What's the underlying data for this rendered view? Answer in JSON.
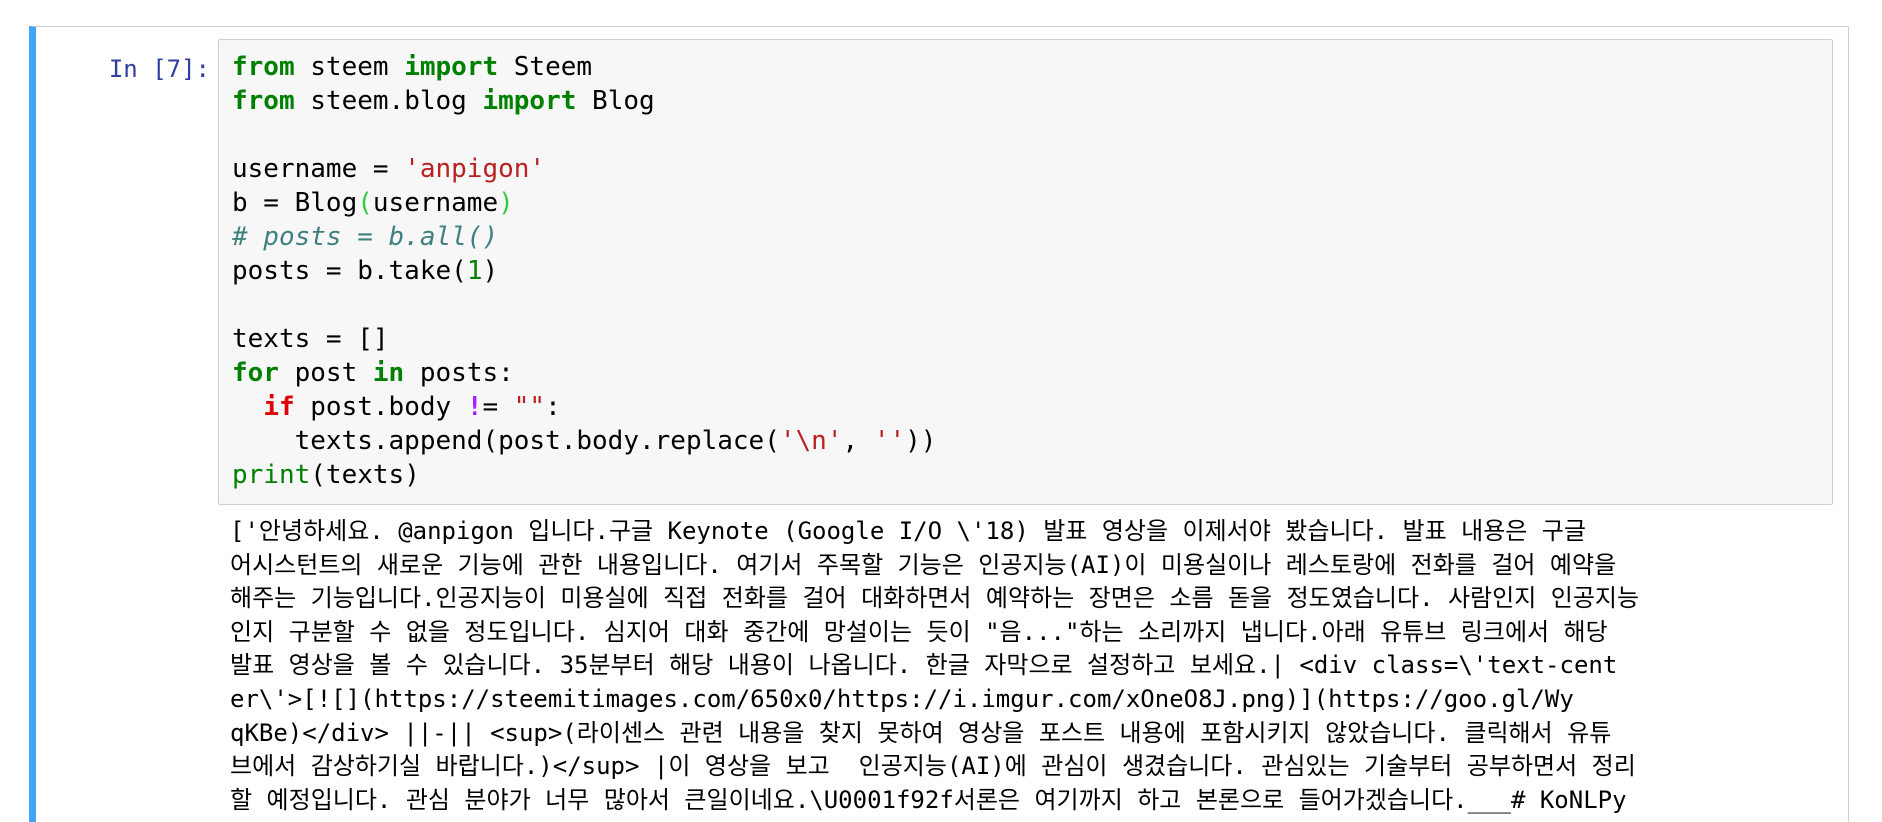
{
  "cell": {
    "prompt": "In [7]:",
    "accent_color": "#42a5f5",
    "code_lines": [
      [
        {
          "t": "from",
          "c": "kw"
        },
        {
          "t": " steem ",
          "c": ""
        },
        {
          "t": "import",
          "c": "kw"
        },
        {
          "t": " Steem",
          "c": ""
        }
      ],
      [
        {
          "t": "from",
          "c": "kw"
        },
        {
          "t": " steem.blog ",
          "c": ""
        },
        {
          "t": "import",
          "c": "kw"
        },
        {
          "t": " Blog",
          "c": ""
        }
      ],
      [],
      [
        {
          "t": "username = ",
          "c": ""
        },
        {
          "t": "'anpigon'",
          "c": "str"
        }
      ],
      [
        {
          "t": "b = Blog",
          "c": ""
        },
        {
          "t": "(",
          "c": "paren-green"
        },
        {
          "t": "username",
          "c": ""
        },
        {
          "t": ")",
          "c": "paren-green"
        }
      ],
      [
        {
          "t": "# posts = b.all()",
          "c": "cmt"
        }
      ],
      [
        {
          "t": "posts = b.take(",
          "c": ""
        },
        {
          "t": "1",
          "c": "num"
        },
        {
          "t": ")",
          "c": ""
        }
      ],
      [],
      [
        {
          "t": "texts = []",
          "c": ""
        }
      ],
      [
        {
          "t": "for",
          "c": "kw"
        },
        {
          "t": " post ",
          "c": ""
        },
        {
          "t": "in",
          "c": "kw"
        },
        {
          "t": " posts:",
          "c": ""
        }
      ],
      [
        {
          "t": "  ",
          "c": ""
        },
        {
          "t": "if",
          "c": "kw-red"
        },
        {
          "t": " post.body ",
          "c": ""
        },
        {
          "t": "!",
          "c": "op-purple"
        },
        {
          "t": "= ",
          "c": ""
        },
        {
          "t": "\"\"",
          "c": "str"
        },
        {
          "t": ":",
          "c": ""
        }
      ],
      [
        {
          "t": "    texts.append(post.body.replace(",
          "c": ""
        },
        {
          "t": "'\\n'",
          "c": "str"
        },
        {
          "t": ", ",
          "c": ""
        },
        {
          "t": "''",
          "c": "str"
        },
        {
          "t": "))",
          "c": ""
        }
      ],
      [
        {
          "t": "print",
          "c": "builtin"
        },
        {
          "t": "(texts)",
          "c": ""
        }
      ]
    ],
    "output_lines": [
      "['안녕하세요. @anpigon 입니다.구글 Keynote (Google I/O \\'18) 발표 영상을 이제서야 봤습니다. 발표 내용은 구글",
      "어시스턴트의 새로운 기능에 관한 내용입니다. 여기서 주목할 기능은 인공지능(AI)이 미용실이나 레스토랑에 전화를 걸어 예약을",
      "해주는 기능입니다.인공지능이 미용실에 직접 전화를 걸어 대화하면서 예약하는 장면은 소름 돋을 정도였습니다. 사람인지 인공지능",
      "인지 구분할 수 없을 정도입니다. 심지어 대화 중간에 망설이는 듯이 \"음...\"하는 소리까지 냅니다.아래 유튜브 링크에서 해당",
      "발표 영상을 볼 수 있습니다. 35분부터 해당 내용이 나옵니다. 한글 자막으로 설정하고 보세요.| <div class=\\'text-cent",
      "er\\'>[![](https://steemitimages.com/650x0/https://i.imgur.com/xOneO8J.png)](https://goo.gl/Wy",
      "qKBe)</div> ||-|| <sup>(라이센스 관련 내용을 찾지 못하여 영상을 포스트 내용에 포함시키지 않았습니다. 클릭해서 유튜",
      "브에서 감상하기실 바랍니다.)</sup> |이 영상을 보고  인공지능(AI)에 관심이 생겼습니다. 관심있는 기술부터 공부하면서 정리",
      "할 예정입니다. 관심 분야가 너무 많아서 큰일이네요.\\U0001f92f서론은 여기까지 하고 본론으로 들어가겠습니다.___# KoNLPy"
    ]
  }
}
